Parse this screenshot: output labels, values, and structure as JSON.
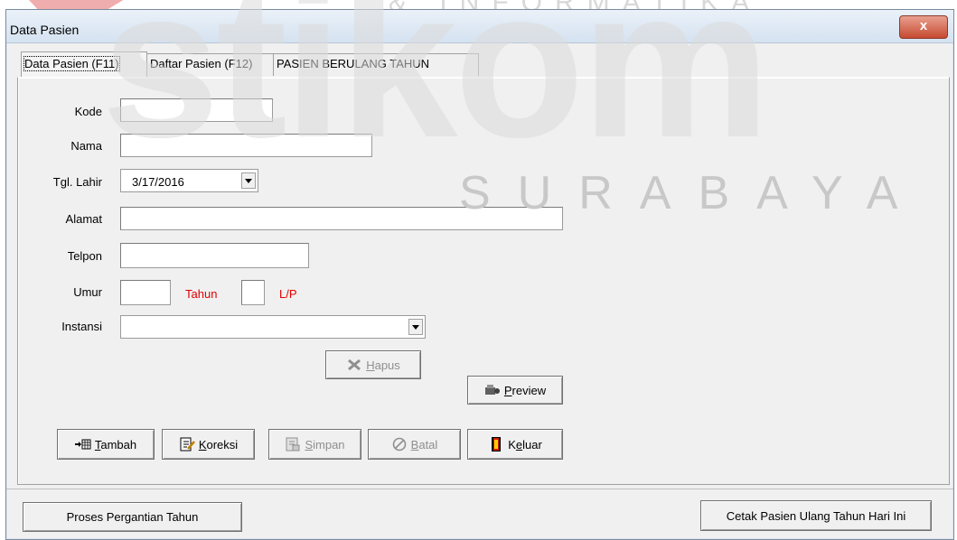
{
  "watermark": {
    "top": "& INFORMATIKA",
    "brand": "stikom",
    "sub": "SURABAYA"
  },
  "window": {
    "title": "Data Pasien",
    "close_label": "x"
  },
  "tabs": [
    {
      "label": "Data Pasien (F11)",
      "active": true
    },
    {
      "label": "Daftar Pasien (F12)",
      "active": false
    },
    {
      "label": "PASIEN BERULANG TAHUN",
      "active": false
    }
  ],
  "form": {
    "kode": {
      "label": "Kode",
      "value": ""
    },
    "nama": {
      "label": "Nama",
      "value": ""
    },
    "tgl_lahir": {
      "label": "Tgl. Lahir",
      "value": "3/17/2016"
    },
    "alamat": {
      "label": "Alamat",
      "value": ""
    },
    "telpon": {
      "label": "Telpon",
      "value": ""
    },
    "umur": {
      "label": "Umur",
      "value": "",
      "unit": "Tahun"
    },
    "jk": {
      "value": "",
      "hint": "L/P"
    },
    "instansi": {
      "label": "Instansi",
      "value": ""
    }
  },
  "buttons": {
    "hapus": {
      "accel": "H",
      "rest": "apus",
      "enabled": false
    },
    "preview": {
      "accel": "P",
      "rest": "review",
      "enabled": true
    },
    "tambah": {
      "accel": "T",
      "rest": "ambah",
      "enabled": true
    },
    "koreksi": {
      "accel": "K",
      "rest": "oreksi",
      "enabled": true
    },
    "simpan": {
      "accel": "S",
      "rest": "impan",
      "enabled": false
    },
    "batal": {
      "accel": "B",
      "rest": "atal",
      "enabled": false
    },
    "keluar_pre": "K",
    "keluar_accel": "e",
    "keluar_rest": "luar"
  },
  "bottom": {
    "proses": "Proses Pergantian Tahun",
    "cetak": "Cetak Pasien Ulang Tahun Hari Ini"
  },
  "colors": {
    "accent_red": "#e00000",
    "close_red": "#c74a30"
  }
}
